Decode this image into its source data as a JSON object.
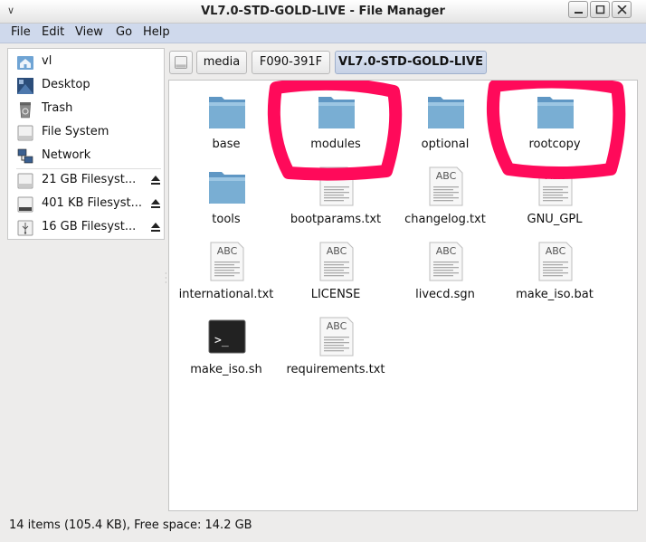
{
  "window": {
    "title": "VL7.0-STD-GOLD-LIVE - File Manager",
    "buttons": [
      "minimize-icon",
      "maximize-icon",
      "close-icon"
    ]
  },
  "menubar": {
    "items": [
      {
        "label": "File"
      },
      {
        "label": "Edit"
      },
      {
        "label": "View"
      },
      {
        "label": "Go"
      },
      {
        "label": "Help"
      }
    ]
  },
  "sidebar": {
    "items": [
      {
        "label": "vl",
        "icon": "home-folder-icon"
      },
      {
        "label": "Desktop",
        "icon": "desktop-icon"
      },
      {
        "label": "Trash",
        "icon": "trash-icon"
      },
      {
        "label": "File System",
        "icon": "drive-icon"
      },
      {
        "label": "Network",
        "icon": "network-icon"
      },
      {
        "label": "21 GB Filesyst...",
        "icon": "drive-icon",
        "ejectable": true
      },
      {
        "label": "401 KB Filesyst...",
        "icon": "drive-icon",
        "ejectable": true
      },
      {
        "label": "16 GB Filesyst...",
        "icon": "usb-drive-icon",
        "ejectable": true
      }
    ]
  },
  "pathbar": {
    "crumbs": [
      {
        "label": "",
        "icon": "drive-icon"
      },
      {
        "label": "media"
      },
      {
        "label": "F090-391F"
      },
      {
        "label": "VL7.0-STD-GOLD-LIVE",
        "active": true
      }
    ]
  },
  "files": [
    {
      "name": "base",
      "type": "folder"
    },
    {
      "name": "modules",
      "type": "folder"
    },
    {
      "name": "optional",
      "type": "folder"
    },
    {
      "name": "rootcopy",
      "type": "folder"
    },
    {
      "name": "tools",
      "type": "folder"
    },
    {
      "name": "bootparams.txt",
      "type": "text"
    },
    {
      "name": "changelog.txt",
      "type": "text"
    },
    {
      "name": "GNU_GPL",
      "type": "text"
    },
    {
      "name": "international.txt",
      "type": "text"
    },
    {
      "name": "LICENSE",
      "type": "text"
    },
    {
      "name": "livecd.sgn",
      "type": "text"
    },
    {
      "name": "make_iso.bat",
      "type": "text"
    },
    {
      "name": "make_iso.sh",
      "type": "script"
    },
    {
      "name": "requirements.txt",
      "type": "text"
    }
  ],
  "text_icon_label": "ABC",
  "script_icon_label": ">_",
  "status": {
    "text": "14 items (105.4 KB), Free space: 14.2 GB"
  },
  "colors": {
    "folder": "#79aed3",
    "menubar": "#cfd9ec",
    "annotation": "#ff0a5a"
  }
}
